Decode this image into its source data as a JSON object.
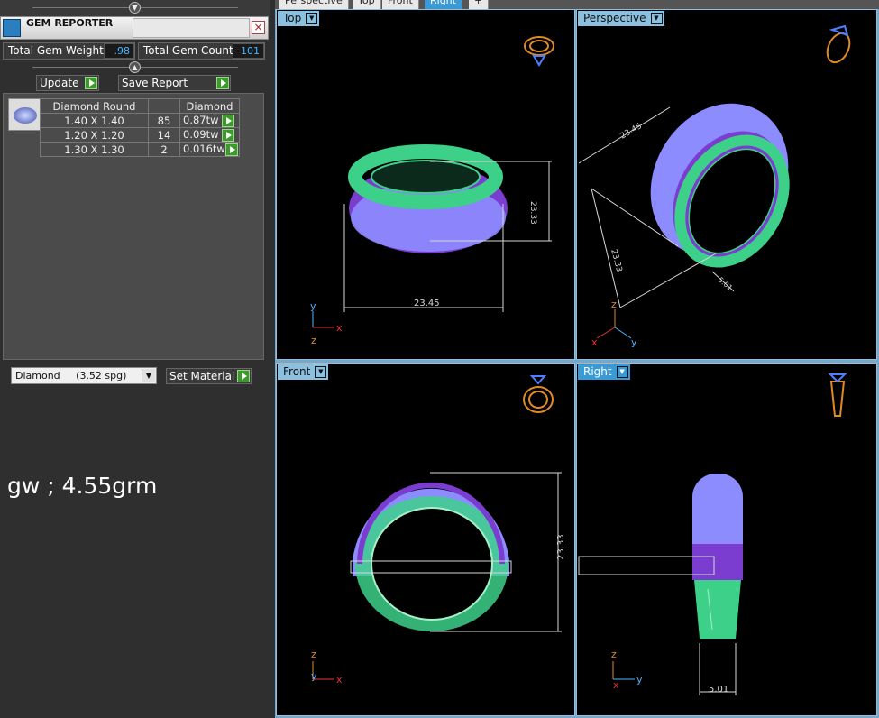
{
  "panel": {
    "title": "GEM REPORTER",
    "total_weight_label": "Total Gem Weight",
    "total_weight_value": ".98",
    "total_count_label": "Total Gem Count",
    "total_count_value": "101",
    "update_label": "Update",
    "save_report_label": "Save Report",
    "table": {
      "headers": [
        "Diamond Round",
        "",
        "Diamond"
      ],
      "rows": [
        {
          "size": "1.40 X 1.40",
          "count": "85",
          "weight": "0.87tw"
        },
        {
          "size": "1.20 X 1.20",
          "count": "14",
          "weight": "0.09tw"
        },
        {
          "size": "1.30 X 1.30",
          "count": "2",
          "weight": "0.016tw"
        }
      ]
    },
    "material_value": "Diamond     (3.52 spg)",
    "set_material_label": "Set Material",
    "note": "gw ; 4.55grm"
  },
  "viewport_tabs": [
    "Perspective",
    "Top",
    "Front",
    "Right",
    "+"
  ],
  "views": {
    "top": {
      "label": "Top",
      "dim_width": "23.45",
      "dim_height": "23.33",
      "axis_a": "y",
      "axis_b": "x",
      "axis_c": "z"
    },
    "perspective": {
      "label": "Perspective",
      "dim_width": "23.45",
      "dim_height": "23.33",
      "dim_depth": "5.01",
      "axis_a": "z",
      "axis_b": "x",
      "axis_c": "y"
    },
    "front": {
      "label": "Front",
      "dim_height": "23.33",
      "axis_a": "z",
      "axis_b": "y",
      "axis_c": "x"
    },
    "right": {
      "label": "Right",
      "dim_depth": "5.01",
      "axis_a": "z",
      "axis_b": "x",
      "axis_c": "y"
    }
  },
  "colors": {
    "metal": "#3dd089",
    "pave": "#8d8cff",
    "pave_dark": "#8a2fc0",
    "dim": "#d8d8d8",
    "widget": "#e08a26"
  }
}
